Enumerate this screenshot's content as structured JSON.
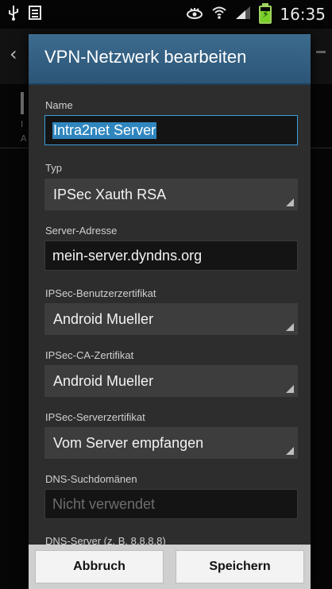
{
  "status_bar": {
    "time": "16:35"
  },
  "dialog": {
    "title": "VPN-Netzwerk bearbeiten",
    "fields": {
      "name": {
        "label": "Name",
        "value": "Intra2net Server"
      },
      "typ": {
        "label": "Typ",
        "value": "IPSec Xauth RSA"
      },
      "server_address": {
        "label": "Server-Adresse",
        "value": "mein-server.dyndns.org"
      },
      "user_cert": {
        "label": "IPSec-Benutzerzertifikat",
        "value": "Android Mueller"
      },
      "ca_cert": {
        "label": "IPSec-CA-Zertifikat",
        "value": "Android Mueller"
      },
      "server_cert": {
        "label": "IPSec-Serverzertifikat",
        "value": "Vom Server empfangen"
      },
      "dns_search": {
        "label": "DNS-Suchdomänen",
        "placeholder": "Nicht verwendet"
      },
      "dns_server": {
        "label": "DNS-Server (z. B. 8.8.8.8)"
      }
    },
    "buttons": {
      "cancel": "Abbruch",
      "save": "Speichern"
    }
  }
}
